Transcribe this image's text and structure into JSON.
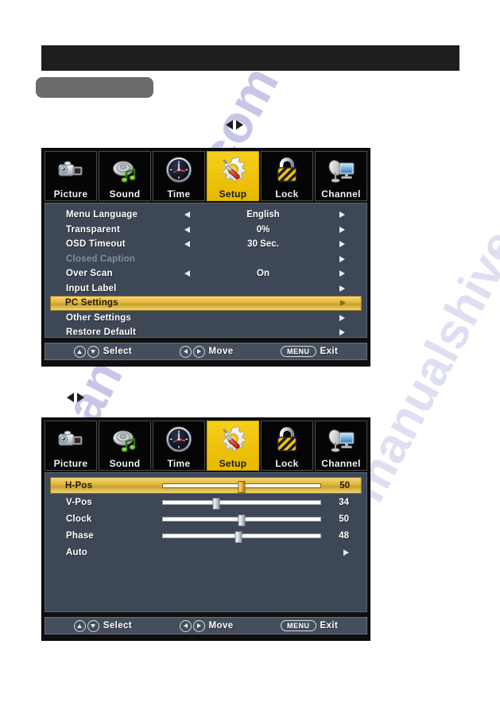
{
  "page": {
    "watermark_right": "manualshive.com",
    "watermark_left": "manualshive.com"
  },
  "colors": {
    "panel_bg": "#3e4756",
    "highlight_gold": "#e3b73c",
    "active_tab": "#f0c400",
    "disabled_text": "#838d9c",
    "text": "#ffffff"
  },
  "nav_hint": {
    "left": "◀",
    "right": "▶"
  },
  "tabs": [
    {
      "label": "Picture",
      "icon": "camcorder-icon",
      "active": false
    },
    {
      "label": "Sound",
      "icon": "speaker-music-icon",
      "active": false
    },
    {
      "label": "Time",
      "icon": "clock-icon",
      "active": false
    },
    {
      "label": "Setup",
      "icon": "gear-screwdriver-icon",
      "active": true
    },
    {
      "label": "Lock",
      "icon": "padlock-icon",
      "active": false
    },
    {
      "label": "Channel",
      "icon": "satellite-monitor-icon",
      "active": false
    }
  ],
  "setup_menu": {
    "rows": [
      {
        "label": "Menu Language",
        "value": "English",
        "left_arrow": true,
        "right_arrow": true,
        "disabled": false,
        "highlighted": false
      },
      {
        "label": "Transparent",
        "value": "0%",
        "left_arrow": true,
        "right_arrow": true,
        "disabled": false,
        "highlighted": false
      },
      {
        "label": "OSD Timeout",
        "value": "30 Sec.",
        "left_arrow": true,
        "right_arrow": true,
        "disabled": false,
        "highlighted": false
      },
      {
        "label": "Closed Caption",
        "value": "",
        "left_arrow": false,
        "right_arrow": true,
        "disabled": true,
        "highlighted": false
      },
      {
        "label": "Over Scan",
        "value": "On",
        "left_arrow": true,
        "right_arrow": true,
        "disabled": false,
        "highlighted": false
      },
      {
        "label": "Input Label",
        "value": "",
        "left_arrow": false,
        "right_arrow": true,
        "disabled": false,
        "highlighted": false
      },
      {
        "label": "PC Settings",
        "value": "",
        "left_arrow": false,
        "right_arrow": true,
        "disabled": false,
        "highlighted": true
      },
      {
        "label": "Other Settings",
        "value": "",
        "left_arrow": false,
        "right_arrow": true,
        "disabled": false,
        "highlighted": false
      },
      {
        "label": "Restore Default",
        "value": "",
        "left_arrow": false,
        "right_arrow": true,
        "disabled": false,
        "highlighted": false
      }
    ]
  },
  "pc_settings_menu": {
    "rows": [
      {
        "label": "H-Pos",
        "value": "50",
        "slider": true,
        "percent": 50,
        "highlighted": true
      },
      {
        "label": "V-Pos",
        "value": "34",
        "slider": true,
        "percent": 34,
        "highlighted": false
      },
      {
        "label": "Clock",
        "value": "50",
        "slider": true,
        "percent": 50,
        "highlighted": false
      },
      {
        "label": "Phase",
        "value": "48",
        "slider": true,
        "percent": 48,
        "highlighted": false
      },
      {
        "label": "Auto",
        "value": "",
        "slider": false,
        "percent": 0,
        "highlighted": false
      }
    ]
  },
  "footer": {
    "select_label": "Select",
    "move_label": "Move",
    "menu_key": "MENU",
    "exit_label": "Exit"
  }
}
